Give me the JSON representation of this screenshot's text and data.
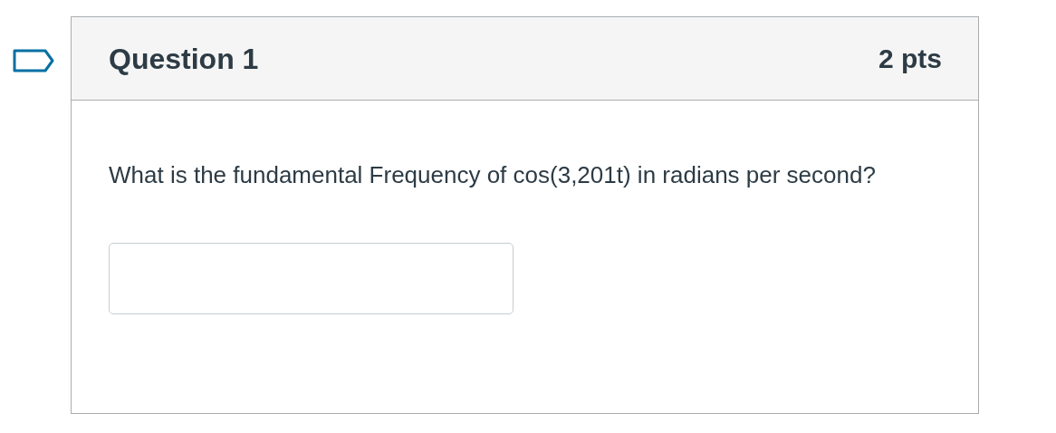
{
  "question": {
    "flagged": false,
    "title": "Question 1",
    "points": "2 pts",
    "text": "What is the fundamental Frequency of cos(3,201t) in radians per second?"
  }
}
